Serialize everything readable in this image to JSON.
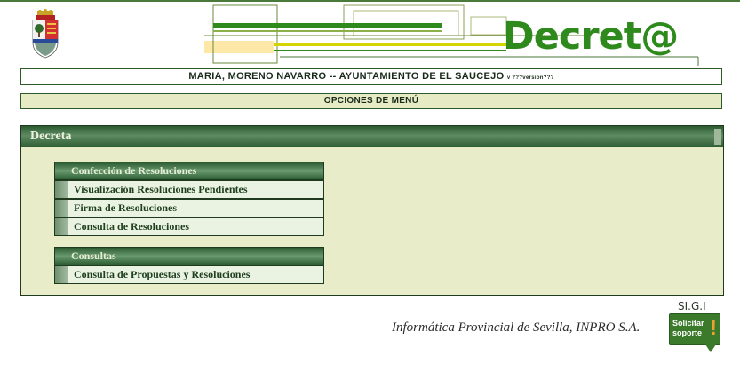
{
  "header": {
    "logo_text": "Decret@",
    "user_line": "MARIA, MORENO NAVARRO -- AYUNTAMIENTO DE EL SAUCEJO",
    "version": "v ???version???"
  },
  "menu_bar": {
    "label": "OPCIONES DE MENÚ"
  },
  "panel": {
    "title": "Decreta",
    "groups": [
      {
        "title": "Confección de Resoluciones",
        "items": [
          "Visualización Resoluciones Pendientes",
          "Firma de Resoluciones",
          "Consulta de Resoluciones"
        ]
      },
      {
        "title": "Consultas",
        "items": [
          "Consulta de Propuestas y Resoluciones"
        ]
      }
    ]
  },
  "footer": {
    "company": "Informática Provincial de Sevilla, INPRO S.A.",
    "sigi_label": "SI.G.I",
    "support_label": "Solicitar soporte"
  },
  "colors": {
    "primary_green": "#2f8a1e",
    "dark_green": "#2b5a31",
    "panel_bg": "#e8ecc8",
    "item_bg": "#eaf3e2"
  }
}
